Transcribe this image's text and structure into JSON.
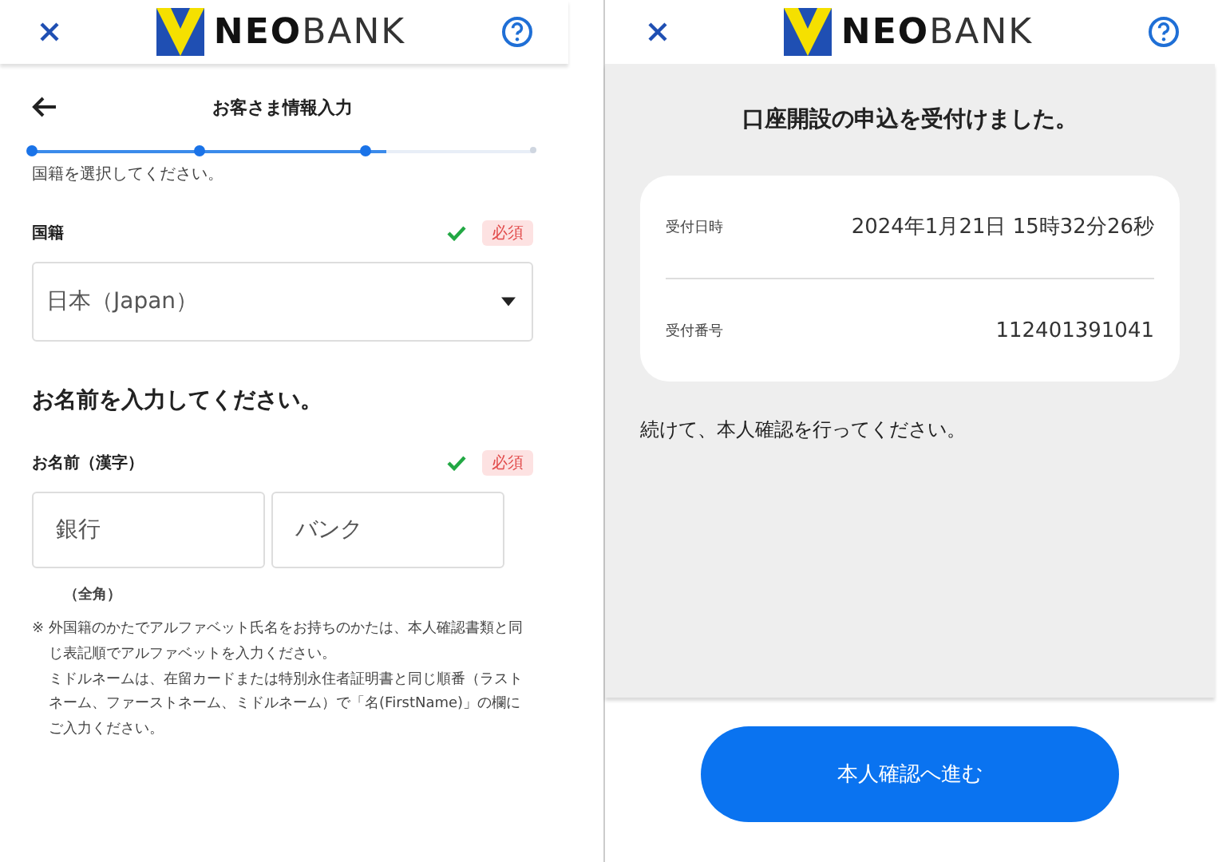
{
  "left_screen": {
    "header": {
      "logo_text": "**NEO**BANK"
    },
    "title": "お客さま情報入力",
    "steps": [
      {
        "done": true
      },
      {
        "done": true
      },
      {
        "done": true
      },
      {
        "done": false
      }
    ],
    "nationality": {
      "prompt": "国籍を選択してください。",
      "label": "国籍",
      "validated": true,
      "required_badge": "必須",
      "value": "日本（Japan）"
    },
    "name": {
      "heading": "お名前を入力してください。",
      "label": "お名前（漢字）",
      "validated": true,
      "required_badge": "必須",
      "last_name": "銀行",
      "first_name": "バンク",
      "hint": "（全角）",
      "note_mark": "※",
      "notes": [
        "外国籍のかたでアルファベット氏名をお持ちのかたは、本人確認書類と同じ表記順でアルファベットを入力ください。",
        "ミドルネームは、在留カードまたは特別永住者証明書と同じ順番（ラストネーム、ファーストネーム、ミドルネーム）で「名(FirstName)」の欄にご入力ください。"
      ]
    }
  },
  "right_screen": {
    "header": {
      "logo_text": "**NEO**BANK"
    },
    "heading": "口座開設の申込を受付けました。",
    "details": [
      {
        "label": "受付日時",
        "value": "2024年1月21日 15時32分26秒"
      },
      {
        "label": "受付番号",
        "value": "112401391041"
      }
    ],
    "instruction": "続けて、本人確認を行ってください。",
    "button": "本人確認へ進む"
  }
}
